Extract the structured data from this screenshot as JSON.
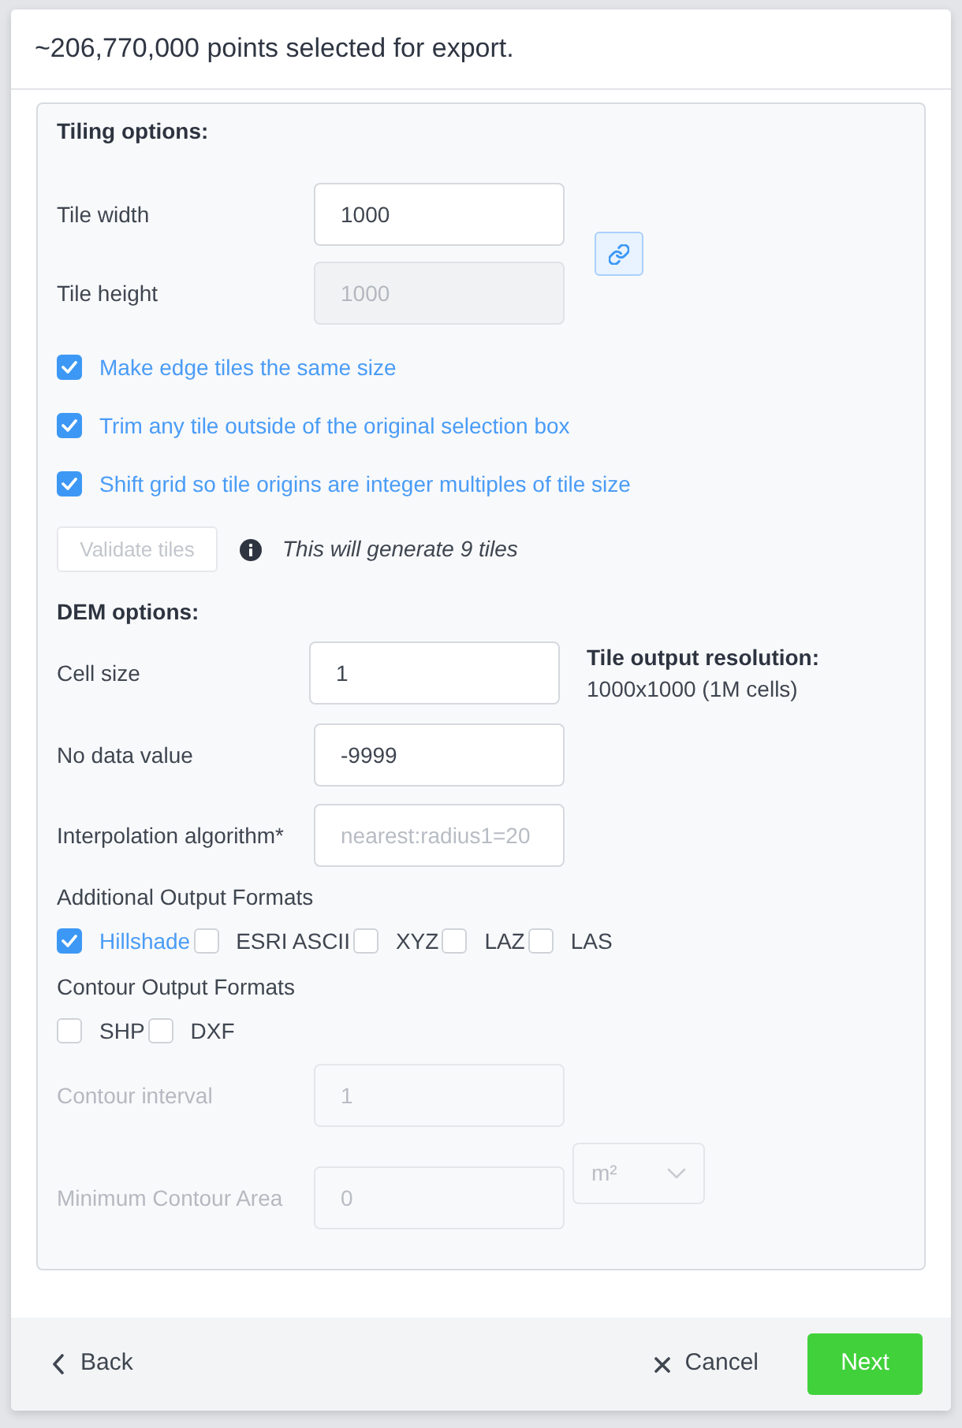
{
  "header": {
    "title": "~206,770,000 points selected for export."
  },
  "tiling": {
    "heading": "Tiling options:",
    "fields": [
      {
        "label": "Tile width",
        "value": "1000",
        "disabled": false
      },
      {
        "label": "Tile height",
        "value": "1000",
        "disabled": true
      }
    ],
    "link_button": {
      "linked": true
    },
    "options": [
      {
        "label": "Make edge tiles the same size",
        "checked": true
      },
      {
        "label": "Trim any tile outside of the original selection box",
        "checked": true
      },
      {
        "label": "Shift grid so tile origins are integer multiples of tile size",
        "checked": true
      }
    ],
    "validate_button": {
      "label": "Validate tiles",
      "disabled": true
    },
    "info_text": "This will generate 9 tiles"
  },
  "dem": {
    "heading": "DEM options:",
    "cell_size": {
      "label": "Cell size",
      "value": "1"
    },
    "resolution": {
      "title": "Tile output resolution:",
      "text": "1000x1000 (1M cells)"
    },
    "no_data": {
      "label": "No data value",
      "value": "-9999"
    },
    "interpolation": {
      "label": "Interpolation algorithm*",
      "placeholder": "nearest:radius1=20"
    },
    "additional_formats": {
      "label": "Additional Output Formats",
      "options": [
        {
          "label": "Hillshade",
          "checked": true
        },
        {
          "label": "ESRI ASCII",
          "checked": false
        },
        {
          "label": "XYZ",
          "checked": false
        },
        {
          "label": "LAZ",
          "checked": false
        },
        {
          "label": "LAS",
          "checked": false
        }
      ]
    },
    "contour_formats": {
      "label": "Contour Output Formats",
      "options": [
        {
          "label": "SHP",
          "checked": false
        },
        {
          "label": "DXF",
          "checked": false
        }
      ]
    },
    "contour_interval": {
      "label": "Contour interval",
      "value": "1",
      "disabled": true
    },
    "min_contour_area": {
      "label": "Minimum Contour Area",
      "value": "0",
      "disabled": true,
      "unit": "m²"
    }
  },
  "footer": {
    "back": "Back",
    "cancel": "Cancel",
    "next": "Next"
  }
}
